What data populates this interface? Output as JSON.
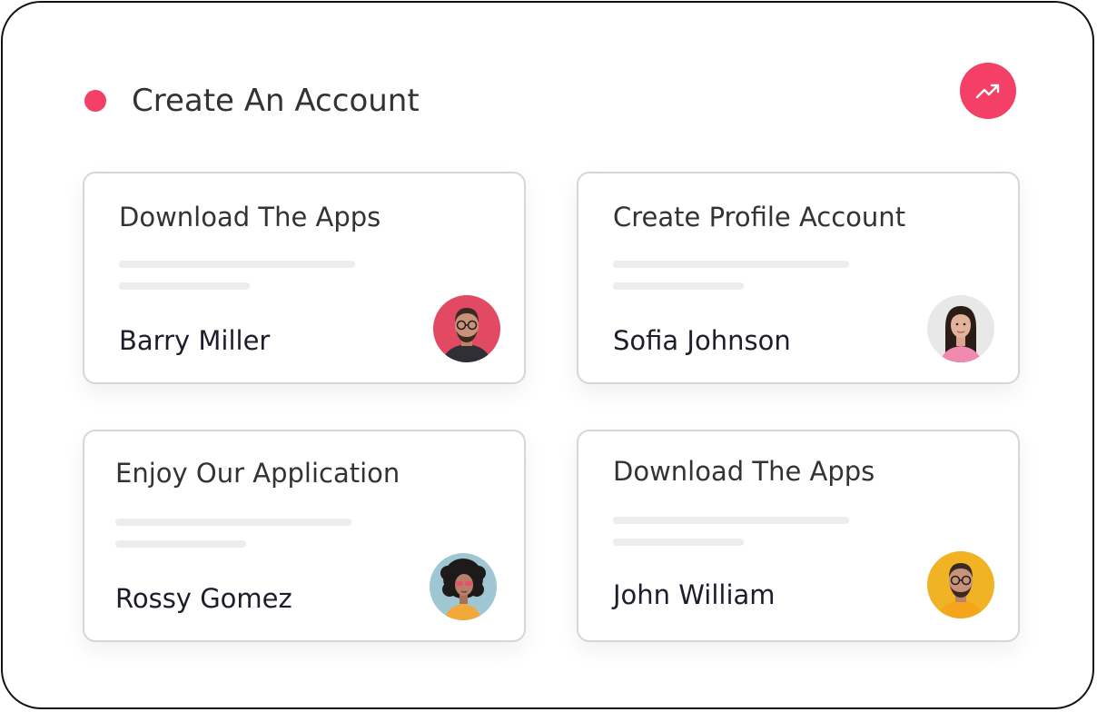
{
  "header": {
    "title": "Create An Account",
    "accent_color": "#f43f66",
    "trend_icon": "trending-up-icon"
  },
  "cards": [
    {
      "title": "Download The Apps",
      "name": "Barry Miller",
      "avatar_bg": "#e24a64",
      "avatar_desc": "man-glasses-beard"
    },
    {
      "title": "Create Profile Account",
      "name": "Sofia Johnson",
      "avatar_bg": "#e8e8e8",
      "avatar_desc": "woman-long-hair"
    },
    {
      "title": "Enjoy Our Application",
      "name": "Rossy Gomez",
      "avatar_bg": "#9fc7d3",
      "avatar_desc": "woman-curly-hair-sunglasses"
    },
    {
      "title": "Download The Apps",
      "name": "John William",
      "avatar_bg": "#f0b324",
      "avatar_desc": "man-glasses-beard"
    }
  ]
}
